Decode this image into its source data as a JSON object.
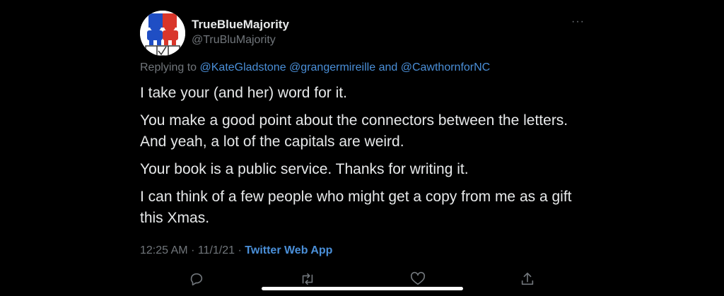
{
  "tweet": {
    "display_name": "TrueBlueMajority",
    "handle": "@TruBluMajority",
    "more_label": "···",
    "replying_prefix": "Replying to",
    "mention_1": "@KateGladstone",
    "mention_2": "@grangermireille",
    "and_word": "and",
    "mention_3": "@CawthornforNC",
    "paragraphs": [
      "I take your (and her) word for it.",
      "You make a good point about the connectors between the letters.  And yeah, a lot of the capitals are weird.",
      "Your book is a public service.  Thanks for writing it.",
      "I can think of a few people who might get a copy from me as a gift this Xmas."
    ],
    "time": "12:25 AM",
    "sep1": "·",
    "date": "11/1/21",
    "sep2": "·",
    "app": "Twitter Web App"
  },
  "actions": [
    "reply-icon",
    "retweet-icon",
    "like-icon",
    "share-icon"
  ],
  "colors": {
    "background": "#000000",
    "text": "#e7e9ea",
    "muted": "#71767b",
    "link": "#4a8fd8"
  }
}
